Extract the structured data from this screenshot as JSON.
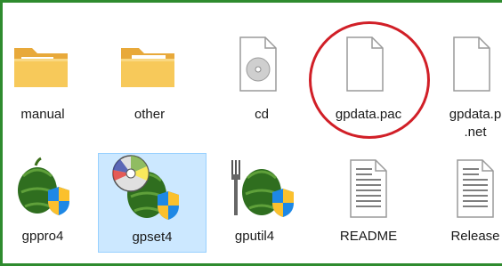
{
  "items_row1": [
    {
      "label": "manual",
      "icon": "folder-icon"
    },
    {
      "label": "other",
      "icon": "folder-icon"
    },
    {
      "label": "cd",
      "icon": "cd-file-icon"
    },
    {
      "label": "gpdata.pac",
      "icon": "blank-file-icon"
    },
    {
      "label_line1": "gpdata.p",
      "label_line2": ".net",
      "icon": "blank-file-icon"
    }
  ],
  "items_row2": [
    {
      "label": "gppro4",
      "icon": "melon-shield-icon"
    },
    {
      "label": "gpset4",
      "icon": "melon-cd-shield-icon",
      "selected": true
    },
    {
      "label": "gputil4",
      "icon": "melon-fork-shield-icon"
    },
    {
      "label": "README",
      "icon": "text-file-icon"
    },
    {
      "label": "Release",
      "icon": "text-file-icon"
    }
  ],
  "colors": {
    "selection_bg": "#cce8ff",
    "selection_border": "#99d1ff",
    "annotation_circle": "#d11f27",
    "frame": "#2e8b2e"
  }
}
